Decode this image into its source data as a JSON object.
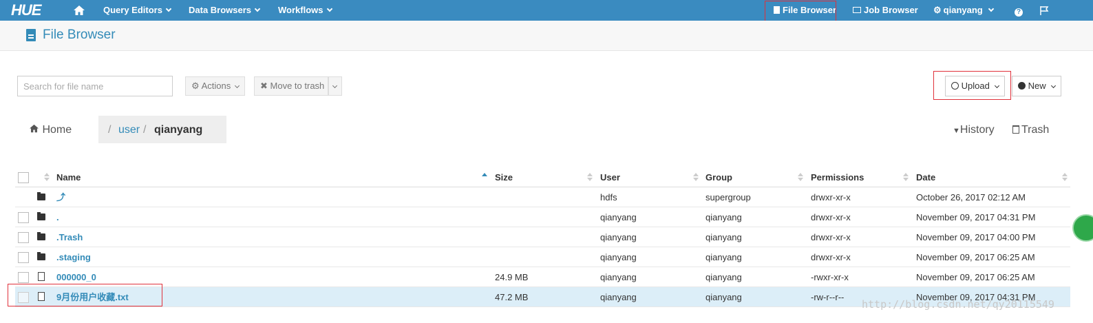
{
  "nav": {
    "logo": "HUE",
    "items": [
      "Query Editors",
      "Data Browsers",
      "Workflows"
    ],
    "file_browser": "File Browser",
    "job_browser": "Job Browser",
    "user": "qianyang"
  },
  "page": {
    "title": "File Browser"
  },
  "toolbar": {
    "search_placeholder": "Search for file name",
    "actions": "Actions",
    "move_to_trash": "Move to trash",
    "upload": "Upload",
    "new": "New"
  },
  "breadcrumb": {
    "home": "Home",
    "sep1": "/",
    "part1": "user",
    "sep2": "/",
    "part2": "qianyang",
    "history": "History",
    "trash": "Trash"
  },
  "table": {
    "headers": {
      "name": "Name",
      "size": "Size",
      "user": "User",
      "group": "Group",
      "permissions": "Permissions",
      "date": "Date"
    },
    "rows": [
      {
        "name": "⤴",
        "size": "",
        "user": "hdfs",
        "group": "supergroup",
        "permissions": "drwxr-xr-x",
        "date": "October 26, 2017 02:12 AM"
      },
      {
        "name": ".",
        "size": "",
        "user": "qianyang",
        "group": "qianyang",
        "permissions": "drwxr-xr-x",
        "date": "November 09, 2017 04:31 PM"
      },
      {
        "name": ".Trash",
        "size": "",
        "user": "qianyang",
        "group": "qianyang",
        "permissions": "drwxr-xr-x",
        "date": "November 09, 2017 04:00 PM"
      },
      {
        "name": ".staging",
        "size": "",
        "user": "qianyang",
        "group": "qianyang",
        "permissions": "drwxr-xr-x",
        "date": "November 09, 2017 06:25 AM"
      },
      {
        "name": "000000_0",
        "size": "24.9 MB",
        "user": "qianyang",
        "group": "qianyang",
        "permissions": "-rwxr-xr-x",
        "date": "November 09, 2017 06:25 AM"
      },
      {
        "name": "9月份用户收藏.txt",
        "size": "47.2 MB",
        "user": "qianyang",
        "group": "qianyang",
        "permissions": "-rw-r--r--",
        "date": "November 09, 2017 04:31 PM"
      }
    ]
  },
  "watermark": "http://blog.csdn.net/qy20115549"
}
